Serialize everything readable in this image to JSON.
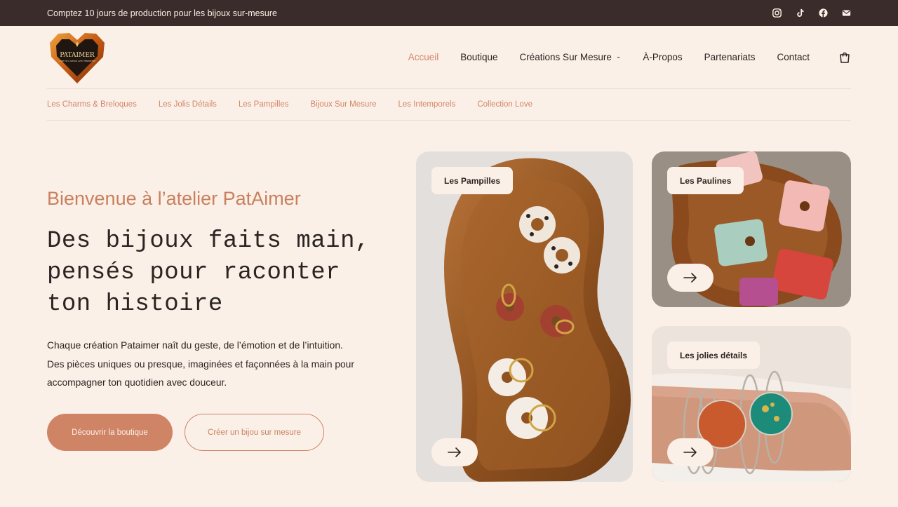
{
  "announcement": "Comptez 10 jours de production pour les bijoux sur-mesure",
  "socials": [
    "instagram-icon",
    "tiktok-icon",
    "facebook-icon",
    "email-icon"
  ],
  "logo": {
    "brand": "PATAIMER",
    "tagline": "L'ART DE L'AMOUR AVEC TENDRESSE"
  },
  "nav": {
    "home": "Accueil",
    "shop": "Boutique",
    "custom": "Créations Sur Mesure",
    "about": "À-Propos",
    "partners": "Partenariats",
    "contact": "Contact"
  },
  "subnav": [
    "Les Charms & Breloques",
    "Les Jolis Détails",
    "Les Pampilles",
    "Bijoux Sur Mesure",
    "Les Intemporels",
    "Collection Love"
  ],
  "hero": {
    "eyebrow": "Bienvenue à l’atelier PatAimer",
    "title_line1": "Des bijoux faits main,",
    "title_line2": "pensés pour raconter",
    "title_line3": "ton histoire",
    "desc_line1": "Chaque création Pataimer naît du geste, de l’émotion et de l’intuition.",
    "desc_line2": "Des pièces uniques ou presque, imaginées et façonnées à la main pour",
    "desc_line3": "accompagner ton quotidien avec douceur.",
    "cta_primary": "Découvrir la boutique",
    "cta_secondary": "Créer un bijou sur mesure"
  },
  "cards": [
    {
      "label": "Les Pampilles"
    },
    {
      "label": "Les Paulines"
    },
    {
      "label": "Les jolies détails"
    }
  ],
  "colors": {
    "background": "#fbf0e8",
    "topbar": "#3a2c2a",
    "accent": "#d08466"
  }
}
